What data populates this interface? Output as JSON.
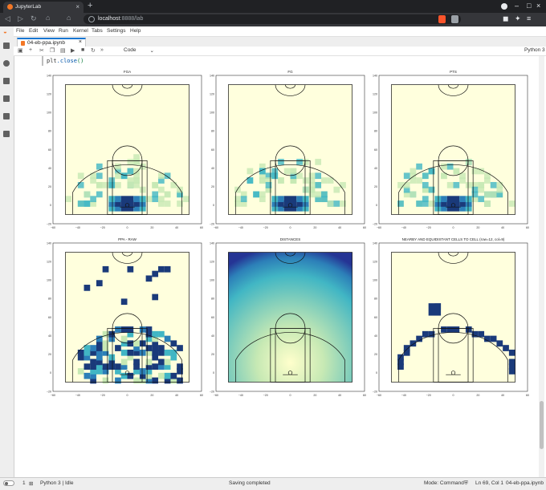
{
  "browser": {
    "tab_title": "JupyterLab",
    "url_host": "localhost",
    "url_rest": ":8888/lab"
  },
  "menu": [
    "File",
    "Edit",
    "View",
    "Run",
    "Kernel",
    "Tabs",
    "Settings",
    "Help"
  ],
  "notebook": {
    "tab_title": "04-eb-ppa.ipynb",
    "cell_type": "Code",
    "kernel": "Python 3",
    "code": {
      "obj": "plt",
      "method": ".close",
      "args": "()"
    }
  },
  "plots": [
    {
      "title": "FGA"
    },
    {
      "title": "FG"
    },
    {
      "title": "PTS"
    },
    {
      "title": "PPA - RAW"
    },
    {
      "title": "DISTANCES"
    },
    {
      "title": "NEARBY AND EQUIDISTANT CELLS TO CELL (row=12, col=9)"
    }
  ],
  "axes": {
    "x_ticks": [
      "−60",
      "−40",
      "−20",
      "0",
      "20",
      "40",
      "60"
    ],
    "y_ticks": [
      "140",
      "120",
      "100",
      "80",
      "60",
      "40",
      "20",
      "0",
      "−20"
    ]
  },
  "colors": {
    "bg_cream": "#ffffdd",
    "dark_navy": "#1a3a7a",
    "mid_blue": "#2c7fb8",
    "teal": "#41b6c4",
    "light_green": "#c7e9b4"
  },
  "status": {
    "count": "1",
    "kernel_status": "Python 3 | Idle",
    "message": "Saving completed",
    "mode": "Mode: Command",
    "position": "Ln 69, Col 1",
    "file": "04-eb-ppa.ipynb"
  }
}
